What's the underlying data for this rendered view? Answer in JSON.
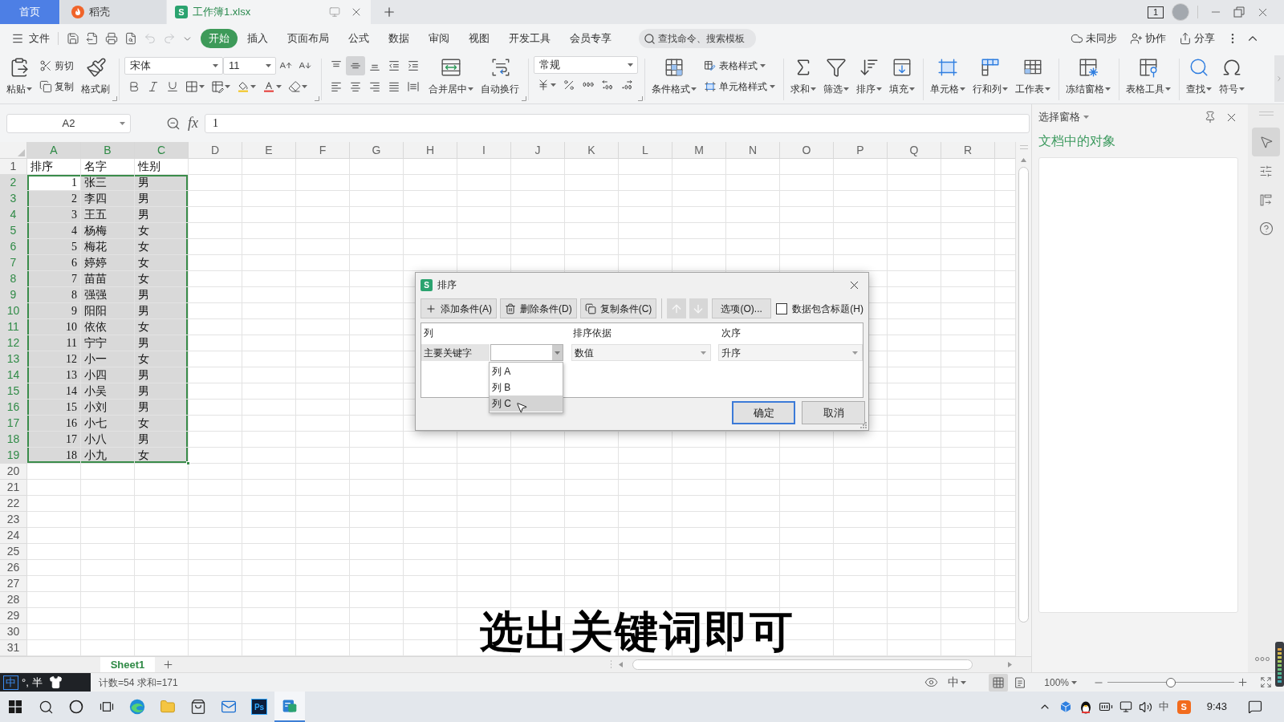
{
  "title_tabs": [
    {
      "label": "首页",
      "kind": "home",
      "selected": false
    },
    {
      "label": "稻壳",
      "kind": "docer",
      "selected": false
    },
    {
      "label": "工作簿1.xlsx",
      "kind": "workbook",
      "logo": "S",
      "selected": true
    }
  ],
  "window_count": "1",
  "menu": {
    "file": "文件",
    "quick_access": [
      {
        "disabled": false
      },
      {
        "disabled": false
      },
      {
        "disabled": false
      },
      {
        "disabled": false
      },
      {
        "disabled": true
      },
      {
        "disabled": true
      },
      {
        "disabled": false
      }
    ],
    "tabs": [
      {
        "label": "开始",
        "selected": true
      },
      {
        "label": "插入",
        "selected": false
      },
      {
        "label": "页面布局",
        "selected": false
      },
      {
        "label": "公式",
        "selected": false
      },
      {
        "label": "数据",
        "selected": false
      },
      {
        "label": "审阅",
        "selected": false
      },
      {
        "label": "视图",
        "selected": false
      },
      {
        "label": "开发工具",
        "selected": false
      },
      {
        "label": "会员专享",
        "selected": false
      }
    ],
    "search": {
      "placeholder": "查找命令、搜索模板"
    },
    "actions": [
      "未同步",
      "协作",
      "分享"
    ]
  },
  "ribbon": [
    {
      "launcher": true,
      "columns": [
        {
          "kind": "large",
          "label": "粘贴",
          "menu": true
        },
        {
          "kind": "stack",
          "rows": [
            [
              {
                "kind": "small",
                "label": "剪切",
                "menu": false
              }
            ],
            [
              {
                "kind": "small",
                "label": "复制",
                "menu": false
              }
            ]
          ]
        },
        {
          "kind": "large",
          "label": "格式刷",
          "menu": false
        }
      ]
    },
    {
      "launcher": true,
      "columns": [
        {
          "kind": "stack",
          "rows": [
            [
              {
                "kind": "combo",
                "value": "宋体"
              },
              {
                "kind": "combo",
                "value": "11"
              },
              {
                "kind": "icon",
                "menu": false
              },
              {
                "kind": "icon",
                "menu": false
              }
            ],
            [
              {
                "kind": "icon",
                "menu": false
              },
              {
                "kind": "icon",
                "menu": false
              },
              {
                "kind": "icon",
                "menu": false
              },
              {
                "kind": "icon",
                "menu": true
              },
              {
                "kind": "icon",
                "menu": true
              },
              {
                "kind": "icon",
                "menu": true
              },
              {
                "kind": "icon",
                "menu": true
              },
              {
                "kind": "icon",
                "menu": true
              }
            ]
          ]
        }
      ]
    },
    {
      "launcher": true,
      "columns": [
        {
          "kind": "stack",
          "rows": [
            [
              {
                "kind": "icon",
                "menu": false,
                "on": false
              },
              {
                "kind": "icon",
                "menu": false,
                "on": true
              },
              {
                "kind": "icon",
                "menu": false,
                "on": false
              },
              {
                "kind": "icon",
                "menu": false,
                "on": false
              },
              {
                "kind": "icon",
                "menu": false,
                "on": false
              }
            ],
            [
              {
                "kind": "icon",
                "menu": false,
                "on": false
              },
              {
                "kind": "icon",
                "menu": false,
                "on": false
              },
              {
                "kind": "icon",
                "menu": false,
                "on": false
              },
              {
                "kind": "icon",
                "menu": false,
                "on": false
              },
              {
                "kind": "icon",
                "menu": false,
                "on": false
              }
            ]
          ]
        },
        {
          "kind": "large",
          "label": "合并居中",
          "menu": true
        },
        {
          "kind": "large",
          "label": "自动换行",
          "menu": false
        }
      ]
    },
    {
      "launcher": true,
      "columns": [
        {
          "kind": "stack",
          "rows": [
            [
              {
                "kind": "combo",
                "value": "常规"
              }
            ],
            [
              {
                "kind": "icon",
                "menu": true
              },
              {
                "kind": "icon",
                "menu": false
              },
              {
                "kind": "icon",
                "menu": false
              },
              {
                "kind": "icon",
                "menu": false
              },
              {
                "kind": "icon",
                "menu": false
              }
            ]
          ]
        }
      ]
    },
    {
      "launcher": false,
      "columns": [
        {
          "kind": "large",
          "label": "条件格式",
          "menu": true
        },
        {
          "kind": "stack",
          "rows": [
            [
              {
                "kind": "small",
                "label": "表格样式",
                "menu": true
              }
            ],
            [
              {
                "kind": "small",
                "label": "单元格样式",
                "menu": true
              }
            ]
          ]
        }
      ]
    },
    {
      "launcher": false,
      "columns": [
        {
          "kind": "large",
          "label": "求和",
          "menu": true
        },
        {
          "kind": "large",
          "label": "筛选",
          "menu": true
        },
        {
          "kind": "large",
          "label": "排序",
          "menu": true
        },
        {
          "kind": "large",
          "label": "填充",
          "menu": true
        }
      ]
    },
    {
      "launcher": false,
      "columns": [
        {
          "kind": "large",
          "label": "单元格",
          "menu": true
        },
        {
          "kind": "large",
          "label": "行和列",
          "menu": true
        },
        {
          "kind": "large",
          "label": "工作表",
          "menu": true
        }
      ]
    },
    {
      "launcher": false,
      "columns": [
        {
          "kind": "large",
          "label": "冻结窗格",
          "menu": true
        }
      ]
    },
    {
      "launcher": false,
      "columns": [
        {
          "kind": "large",
          "label": "表格工具",
          "menu": true
        }
      ]
    },
    {
      "launcher": false,
      "columns": [
        {
          "kind": "large",
          "label": "查找",
          "menu": true
        },
        {
          "kind": "large",
          "label": "符号",
          "menu": true
        }
      ]
    }
  ],
  "formula_bar": {
    "cell_ref": "A2",
    "function_label": "fx",
    "formula": "1"
  },
  "sheet": {
    "columns": [
      {
        "label": "A",
        "selected": true
      },
      {
        "label": "B",
        "selected": true
      },
      {
        "label": "C",
        "selected": true
      },
      {
        "label": "D",
        "selected": false
      },
      {
        "label": "E",
        "selected": false
      },
      {
        "label": "F",
        "selected": false
      },
      {
        "label": "G",
        "selected": false
      },
      {
        "label": "H",
        "selected": false
      },
      {
        "label": "I",
        "selected": false
      },
      {
        "label": "J",
        "selected": false
      },
      {
        "label": "K",
        "selected": false
      },
      {
        "label": "L",
        "selected": false
      },
      {
        "label": "M",
        "selected": false
      },
      {
        "label": "N",
        "selected": false
      },
      {
        "label": "O",
        "selected": false
      },
      {
        "label": "P",
        "selected": false
      },
      {
        "label": "Q",
        "selected": false
      },
      {
        "label": "R",
        "selected": false
      }
    ],
    "rows": [
      {
        "number": "1",
        "selected": false,
        "cells": [
          {
            "text": "排序",
            "kind": "text",
            "active": false
          },
          {
            "text": "名字",
            "kind": "text",
            "active": false
          },
          {
            "text": "性别",
            "kind": "text",
            "active": false
          }
        ]
      },
      {
        "number": "2",
        "selected": true,
        "cells": [
          {
            "text": "1",
            "kind": "number",
            "active": true
          },
          {
            "text": "张三",
            "kind": "text",
            "active": false
          },
          {
            "text": "男",
            "kind": "text",
            "active": false
          }
        ]
      },
      {
        "number": "3",
        "selected": true,
        "cells": [
          {
            "text": "2",
            "kind": "number",
            "active": false
          },
          {
            "text": "李四",
            "kind": "text",
            "active": false
          },
          {
            "text": "男",
            "kind": "text",
            "active": false
          }
        ]
      },
      {
        "number": "4",
        "selected": true,
        "cells": [
          {
            "text": "3",
            "kind": "number",
            "active": false
          },
          {
            "text": "王五",
            "kind": "text",
            "active": false
          },
          {
            "text": "男",
            "kind": "text",
            "active": false
          }
        ]
      },
      {
        "number": "5",
        "selected": true,
        "cells": [
          {
            "text": "4",
            "kind": "number",
            "active": false
          },
          {
            "text": "杨梅",
            "kind": "text",
            "active": false
          },
          {
            "text": "女",
            "kind": "text",
            "active": false
          }
        ]
      },
      {
        "number": "6",
        "selected": true,
        "cells": [
          {
            "text": "5",
            "kind": "number",
            "active": false
          },
          {
            "text": "梅花",
            "kind": "text",
            "active": false
          },
          {
            "text": "女",
            "kind": "text",
            "active": false
          }
        ]
      },
      {
        "number": "7",
        "selected": true,
        "cells": [
          {
            "text": "6",
            "kind": "number",
            "active": false
          },
          {
            "text": "婷婷",
            "kind": "text",
            "active": false
          },
          {
            "text": "女",
            "kind": "text",
            "active": false
          }
        ]
      },
      {
        "number": "8",
        "selected": true,
        "cells": [
          {
            "text": "7",
            "kind": "number",
            "active": false
          },
          {
            "text": "苗苗",
            "kind": "text",
            "active": false
          },
          {
            "text": "女",
            "kind": "text",
            "active": false
          }
        ]
      },
      {
        "number": "9",
        "selected": true,
        "cells": [
          {
            "text": "8",
            "kind": "number",
            "active": false
          },
          {
            "text": "强强",
            "kind": "text",
            "active": false
          },
          {
            "text": "男",
            "kind": "text",
            "active": false
          }
        ]
      },
      {
        "number": "10",
        "selected": true,
        "cells": [
          {
            "text": "9",
            "kind": "number",
            "active": false
          },
          {
            "text": "阳阳",
            "kind": "text",
            "active": false
          },
          {
            "text": "男",
            "kind": "text",
            "active": false
          }
        ]
      },
      {
        "number": "11",
        "selected": true,
        "cells": [
          {
            "text": "10",
            "kind": "number",
            "active": false
          },
          {
            "text": "依依",
            "kind": "text",
            "active": false
          },
          {
            "text": "女",
            "kind": "text",
            "active": false
          }
        ]
      },
      {
        "number": "12",
        "selected": true,
        "cells": [
          {
            "text": "11",
            "kind": "number",
            "active": false
          },
          {
            "text": "宁宁",
            "kind": "text",
            "active": false
          },
          {
            "text": "男",
            "kind": "text",
            "active": false
          }
        ]
      },
      {
        "number": "13",
        "selected": true,
        "cells": [
          {
            "text": "12",
            "kind": "number",
            "active": false
          },
          {
            "text": "小一",
            "kind": "text",
            "active": false
          },
          {
            "text": "女",
            "kind": "text",
            "active": false
          }
        ]
      },
      {
        "number": "14",
        "selected": true,
        "cells": [
          {
            "text": "13",
            "kind": "number",
            "active": false
          },
          {
            "text": "小四",
            "kind": "text",
            "active": false
          },
          {
            "text": "男",
            "kind": "text",
            "active": false
          }
        ]
      },
      {
        "number": "15",
        "selected": true,
        "cells": [
          {
            "text": "14",
            "kind": "number",
            "active": false
          },
          {
            "text": "小吴",
            "kind": "text",
            "active": false
          },
          {
            "text": "男",
            "kind": "text",
            "active": false
          }
        ]
      },
      {
        "number": "16",
        "selected": true,
        "cells": [
          {
            "text": "15",
            "kind": "number",
            "active": false
          },
          {
            "text": "小刘",
            "kind": "text",
            "active": false
          },
          {
            "text": "男",
            "kind": "text",
            "active": false
          }
        ]
      },
      {
        "number": "17",
        "selected": true,
        "cells": [
          {
            "text": "16",
            "kind": "number",
            "active": false
          },
          {
            "text": "小七",
            "kind": "text",
            "active": false
          },
          {
            "text": "女",
            "kind": "text",
            "active": false
          }
        ]
      },
      {
        "number": "18",
        "selected": true,
        "cells": [
          {
            "text": "17",
            "kind": "number",
            "active": false
          },
          {
            "text": "小八",
            "kind": "text",
            "active": false
          },
          {
            "text": "男",
            "kind": "text",
            "active": false
          }
        ]
      },
      {
        "number": "19",
        "selected": true,
        "cells": [
          {
            "text": "18",
            "kind": "number",
            "active": false
          },
          {
            "text": "小九",
            "kind": "text",
            "active": false
          },
          {
            "text": "女",
            "kind": "text",
            "active": false
          }
        ]
      },
      {
        "number": "20",
        "selected": false
      },
      {
        "number": "21",
        "selected": false
      },
      {
        "number": "22",
        "selected": false
      },
      {
        "number": "23",
        "selected": false
      },
      {
        "number": "24",
        "selected": false
      },
      {
        "number": "25",
        "selected": false
      },
      {
        "number": "26",
        "selected": false
      },
      {
        "number": "27",
        "selected": false
      },
      {
        "number": "28",
        "selected": false
      },
      {
        "number": "29",
        "selected": false
      },
      {
        "number": "30",
        "selected": false
      },
      {
        "number": "31",
        "selected": false
      }
    ],
    "tabs": [
      {
        "label": "Sheet1",
        "selected": true
      }
    ]
  },
  "selection_pane": {
    "title": "选择窗格",
    "heading": "文档中的对象"
  },
  "side_tools": [
    {
      "selected": true
    },
    {
      "selected": false
    },
    {
      "selected": false
    },
    {
      "selected": false
    }
  ],
  "sort_dialog": {
    "logo": "S",
    "title": "排序",
    "toolbar": [
      {
        "kind": "add",
        "label": "添加条件(A)",
        "disabled": false
      },
      {
        "kind": "delete",
        "label": "删除条件(D)",
        "disabled": false
      },
      {
        "kind": "copy",
        "label": "复制条件(C)",
        "disabled": false
      },
      {
        "kind": "move_up",
        "disabled": true
      },
      {
        "kind": "move_down",
        "disabled": true
      },
      {
        "kind": "options",
        "label": "选项(O)...",
        "disabled": false
      }
    ],
    "header_checkbox": {
      "label": "数据包含标题(H)",
      "checked": false
    },
    "columns": [
      "列",
      "排序依据",
      "次序"
    ],
    "conditions": [
      {
        "label": "主要关键字",
        "column": {
          "expanded": true,
          "options": [
            {
              "label": "列 A",
              "selected": false
            },
            {
              "label": "列 B",
              "selected": false
            },
            {
              "label": "列 C",
              "selected": true
            }
          ]
        },
        "sort_on": "数值",
        "order": "升序"
      }
    ],
    "buttons": [
      {
        "label": "确定",
        "kind": "primary"
      },
      {
        "label": "取消",
        "kind": "secondary"
      }
    ]
  },
  "caption": "选出关键词即可",
  "status_bar": {
    "ime": {
      "mode": "中",
      "punctuation": "°,",
      "width": "半"
    },
    "summary": "计数=54 求和=171",
    "language": "中",
    "views": [
      {
        "selected": true
      },
      {
        "selected": false
      }
    ],
    "zoom": {
      "label": "100%",
      "level": 0.5
    }
  },
  "taskbar": {
    "apps": [
      {
        "kind": "edge",
        "selected": false
      },
      {
        "kind": "explorer",
        "selected": false
      },
      {
        "kind": "store",
        "selected": false
      },
      {
        "kind": "mail",
        "selected": false
      },
      {
        "kind": "photoshop",
        "label": "Ps",
        "selected": false
      },
      {
        "kind": "wps",
        "selected": true
      }
    ],
    "tray_ime": "中",
    "tray_logo": "S",
    "clock": "9:43"
  }
}
